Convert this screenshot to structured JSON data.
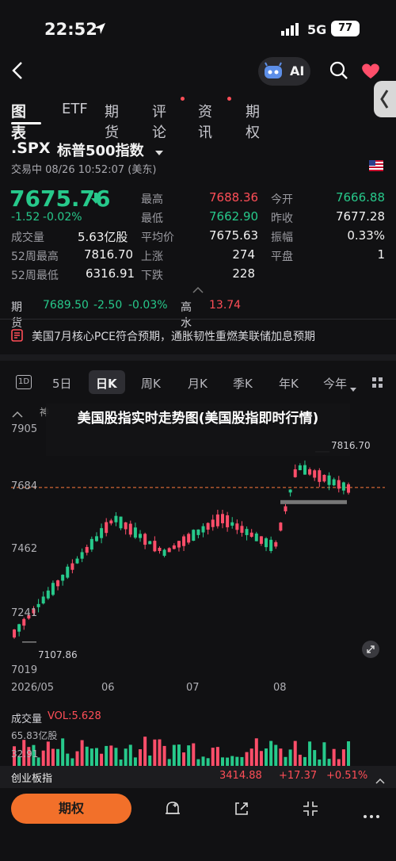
{
  "status_bar": {
    "time": "22:52",
    "network": "5G",
    "battery": "77"
  },
  "nav": {
    "ai_label": "AI"
  },
  "tabs": [
    {
      "label": "图表",
      "active": true,
      "dot": false
    },
    {
      "label": "ETF",
      "active": false,
      "dot": false
    },
    {
      "label": "期货",
      "active": false,
      "dot": false
    },
    {
      "label": "评论",
      "active": false,
      "dot": true
    },
    {
      "label": "资讯",
      "active": false,
      "dot": true
    },
    {
      "label": "期权",
      "active": false,
      "dot": false
    }
  ],
  "stock": {
    "symbol": ".SPX",
    "name": "标普500指数",
    "trade_status": "交易中 08/26 10:52:07 (美东)",
    "price": "7675.76",
    "change": "-1.52",
    "change_pct": "-0.02%"
  },
  "stats": {
    "volume_label": "成交量",
    "volume": "5.63亿股",
    "w52_high_label": "52周最高",
    "w52_high": "7816.70",
    "w52_low_label": "52周最低",
    "w52_low": "6316.91",
    "high_label": "最高",
    "high": "7688.36",
    "low_label": "最低",
    "low": "7662.90",
    "avg_label": "平均价",
    "avg": "7675.63",
    "up_label": "上涨",
    "up": "274",
    "down_label": "下跌",
    "down": "228",
    "open_label": "今开",
    "open": "7666.88",
    "prev_close_label": "昨收",
    "prev_close": "7677.28",
    "amp_label": "振幅",
    "amp": "0.33%",
    "flat_label": "平盘",
    "flat": "1"
  },
  "futures": {
    "label": "期货",
    "price": "7689.50",
    "change": "-2.50",
    "change_pct": "-0.03%",
    "highwater_label": "高水",
    "highwater": "13.74"
  },
  "news": {
    "text": "美国7月核心PCE符合预期，通胀韧性重燃美联储加息预期"
  },
  "periods": [
    "1D",
    "5日",
    "日K",
    "周K",
    "月K",
    "季K",
    "年K",
    "今年"
  ],
  "chart": {
    "legend_partial": "神",
    "overlay_title": "美国股指实时走势图(美国股指即时行情)",
    "y_labels": [
      "7905",
      "7684",
      "7462",
      "7241",
      "7019"
    ],
    "x_labels": [
      "2026/05",
      "06",
      "07",
      "08"
    ],
    "high_marker": "7816.70",
    "low_marker": "7107.86"
  },
  "volume": {
    "label": "成交量",
    "vol": "VOL:5.628",
    "max": "65.83亿股",
    "partial": "32.91"
  },
  "ticker": {
    "name": "创业板指",
    "price": "3414.88",
    "change": "+17.37",
    "pct": "+0.51%"
  },
  "bottom": {
    "options_button": "期权"
  },
  "chart_data": {
    "type": "candlestick",
    "x_labels": [
      "2026/05",
      "06",
      "07",
      "08"
    ],
    "y_ticks": [
      7905,
      7684,
      7462,
      7241,
      7019
    ],
    "ylim": [
      7019,
      7905
    ],
    "high": 7816.7,
    "low": 7107.86,
    "reference_line": 7684
  }
}
